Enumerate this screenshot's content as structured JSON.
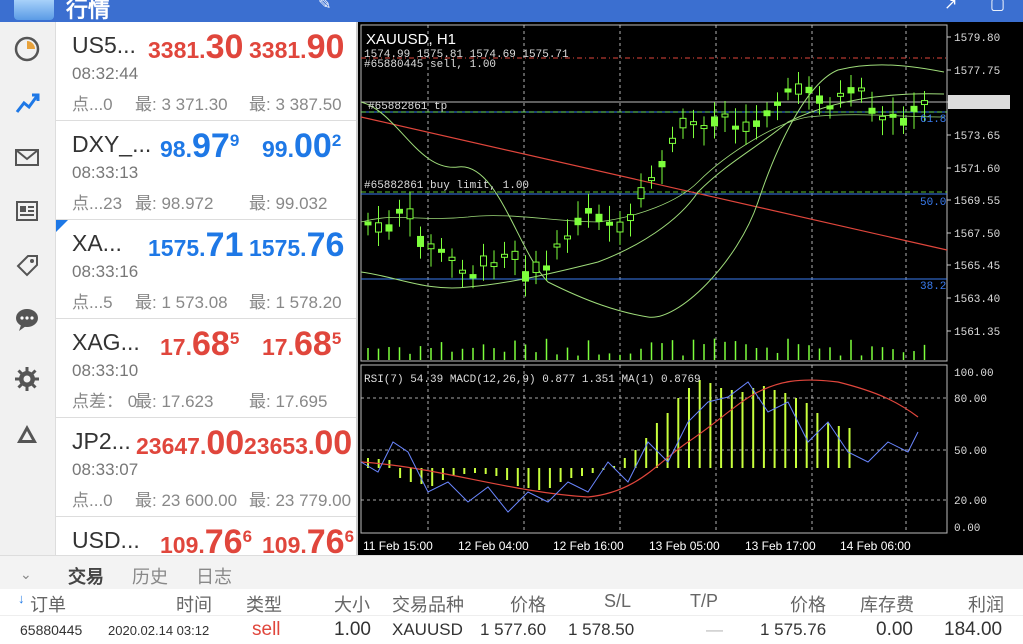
{
  "header": {
    "title": "行情"
  },
  "quotes": [
    {
      "symbol": "US5...",
      "time": "08:32:44",
      "sub": "点...0",
      "low": "最: 3 371.30",
      "high": "最: 3 387.50",
      "bid_main": "3381.",
      "bid_big": "30",
      "bid_sup": "",
      "ask_main": "3381.",
      "ask_big": "90",
      "ask_sup": "",
      "color": "red"
    },
    {
      "symbol": "DXY_...",
      "time": "08:33:13",
      "sub": "点...23",
      "low": "最: 98.972",
      "high": "最: 99.032",
      "bid_main": "98.",
      "bid_big": "97",
      "bid_sup": "9",
      "ask_main": "99.",
      "ask_big": "00",
      "ask_sup": "2",
      "color": "blue"
    },
    {
      "symbol": "XA...",
      "time": "08:33:16",
      "sub": "点...5",
      "low": "最: 1 573.08",
      "high": "最: 1 578.20",
      "bid_main": "1575.",
      "bid_big": "71",
      "bid_sup": "",
      "ask_main": "1575.",
      "ask_big": "76",
      "ask_sup": "",
      "color": "blue"
    },
    {
      "symbol": "XAG...",
      "time": "08:33:10",
      "sub": "点差： 0",
      "low": "最: 17.623",
      "high": "最: 17.695",
      "bid_main": "17.",
      "bid_big": "68",
      "bid_sup": "5",
      "ask_main": "17.",
      "ask_big": "68",
      "ask_sup": "5",
      "color": "red"
    },
    {
      "symbol": "JP2...",
      "time": "08:33:07",
      "sub": "点...0",
      "low": "最: 23 600.00",
      "high": "最: 23 779.00",
      "bid_main": "23647.",
      "bid_big": "00",
      "bid_sup": "",
      "ask_main": "23653.",
      "ask_big": "00",
      "ask_sup": "",
      "color": "red"
    },
    {
      "symbol": "USD...",
      "time": "",
      "sub": "",
      "low": "",
      "high": "",
      "bid_main": "109.",
      "bid_big": "76",
      "bid_sup": "6",
      "ask_main": "109.",
      "ask_big": "76",
      "ask_sup": "6",
      "color": "red"
    }
  ],
  "chart": {
    "title": "XAUUSD, H1",
    "ohlc_line": "1574.99 1575.81 1574.69 1575.71",
    "order_sell": "#65880445 sell, 1.00",
    "order_tp": "#65882861 tp",
    "order_buy_limit": "#65882861 buy limit, 1.00",
    "fib_618": "61.8",
    "fib_500": "50.0",
    "fib_382": "38.2",
    "price_labels": [
      "1579.80",
      "1577.75",
      "1575.71",
      "1573.65",
      "1571.60",
      "1569.55",
      "1567.50",
      "1565.45",
      "1563.40",
      "1561.35"
    ],
    "indicator_label": "RSI(7) 54.39 MACD(12,26,9) 0.877 1.351 MA(1) 0.8769",
    "indicator_levels": [
      "100.00",
      "80.00",
      "50.00",
      "20.00",
      "0.00"
    ],
    "time_labels": [
      "11 Feb 15:00",
      "12 Feb 04:00",
      "12 Feb 16:00",
      "13 Feb 05:00",
      "13 Feb 17:00",
      "14 Feb 06:00"
    ]
  },
  "tabs": [
    "交易",
    "历史",
    "日志"
  ],
  "table": {
    "headers": [
      "订单",
      "时间",
      "类型",
      "大小",
      "交易品种",
      "价格",
      "S/L",
      "T/P",
      "价格",
      "库存费",
      "利润"
    ],
    "row": [
      "65880445",
      "2020.02.14 03:12",
      "sell",
      "1.00",
      "XAUUSD",
      "1 577.60",
      "1 578.50",
      "—",
      "1 575.76",
      "0.00",
      "184.00"
    ]
  },
  "colors": {
    "accent": "#1e78e6",
    "up": "#1e78e6",
    "down": "#e0463c",
    "chart_bg": "#000000",
    "candle": "#7dff3c"
  }
}
